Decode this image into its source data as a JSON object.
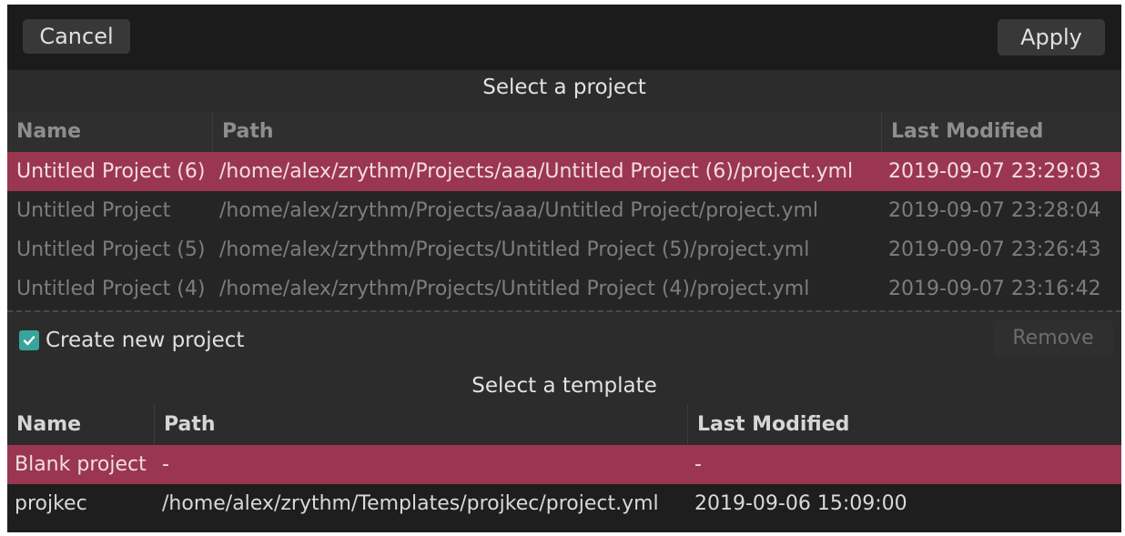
{
  "header": {
    "cancel_label": "Cancel",
    "apply_label": "Apply"
  },
  "projects": {
    "title": "Select a project",
    "columns": [
      "Name",
      "Path",
      "Last Modified"
    ],
    "rows": [
      {
        "name": "Untitled Project (6)",
        "path": "/home/alex/zrythm/Projects/aaa/Untitled Project (6)/project.yml",
        "modified": "2019-09-07 23:29:03",
        "selected": true
      },
      {
        "name": "Untitled Project",
        "path": "/home/alex/zrythm/Projects/aaa/Untitled Project/project.yml",
        "modified": "2019-09-07 23:28:04",
        "selected": false
      },
      {
        "name": "Untitled Project (5)",
        "path": "/home/alex/zrythm/Projects/Untitled Project (5)/project.yml",
        "modified": "2019-09-07 23:26:43",
        "selected": false
      },
      {
        "name": "Untitled Project (4)",
        "path": "/home/alex/zrythm/Projects/Untitled Project (4)/project.yml",
        "modified": "2019-09-07 23:16:42",
        "selected": false
      }
    ]
  },
  "options": {
    "create_new_label": "Create new project",
    "create_new_checked": true,
    "remove_label": "Remove"
  },
  "templates": {
    "title": "Select a template",
    "columns": [
      "Name",
      "Path",
      "Last Modified"
    ],
    "rows": [
      {
        "name": "Blank project",
        "path": "-",
        "modified": "-",
        "selected": true
      },
      {
        "name": "projkec",
        "path": "/home/alex/zrythm/Templates/projkec/project.yml",
        "modified": "2019-09-06 15:09:00",
        "selected": false
      }
    ]
  },
  "colors": {
    "accent_selection": "#9b3651",
    "checkbox": "#3aa39b"
  },
  "icons": {
    "checkbox": "checkmark-icon"
  }
}
